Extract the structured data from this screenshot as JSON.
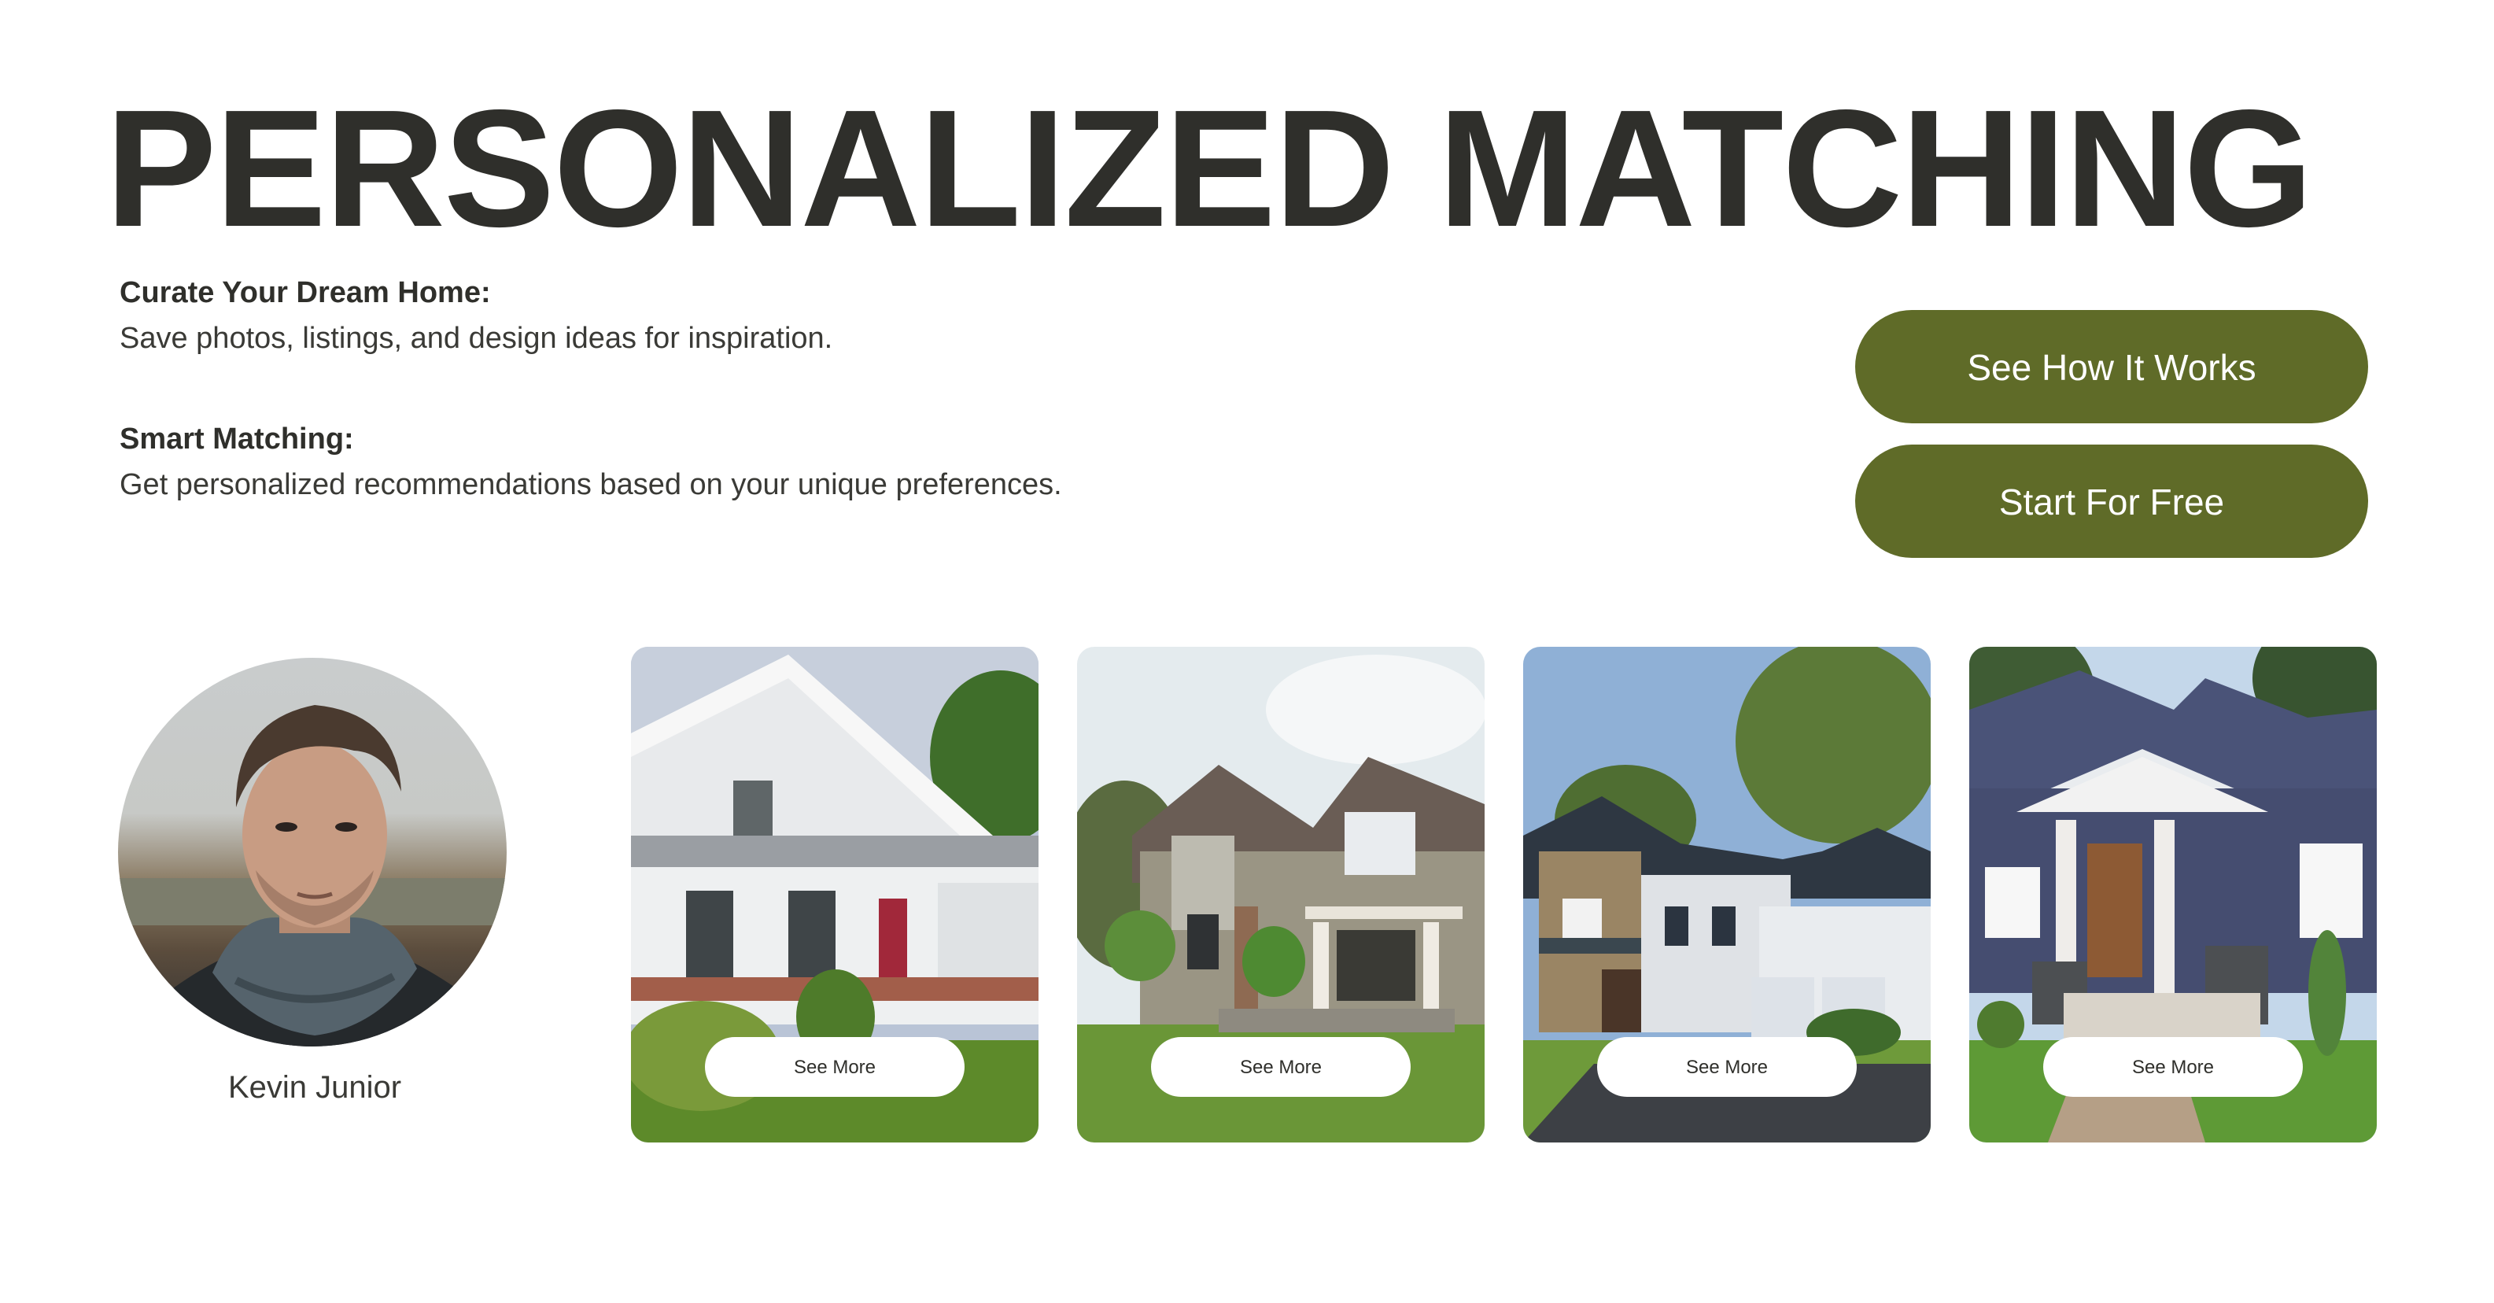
{
  "title": "PERSONALIZED MATCHING",
  "features": [
    {
      "heading": "Curate Your Dream Home:",
      "text": "Save photos, listings, and design ideas for inspiration."
    },
    {
      "heading": "Smart Matching:",
      "text": "Get personalized recommendations based on your unique preferences."
    }
  ],
  "buttons": {
    "see_how": "See How It Works",
    "start_free": "Start For Free"
  },
  "profile": {
    "name": "Kevin Junior"
  },
  "cards": [
    {
      "button_label": "See More"
    },
    {
      "button_label": "See More"
    },
    {
      "button_label": "See More"
    },
    {
      "button_label": "See More"
    }
  ],
  "colors": {
    "accent": "#5f6b28",
    "text": "#2f2f2b",
    "background": "#ffffff"
  }
}
